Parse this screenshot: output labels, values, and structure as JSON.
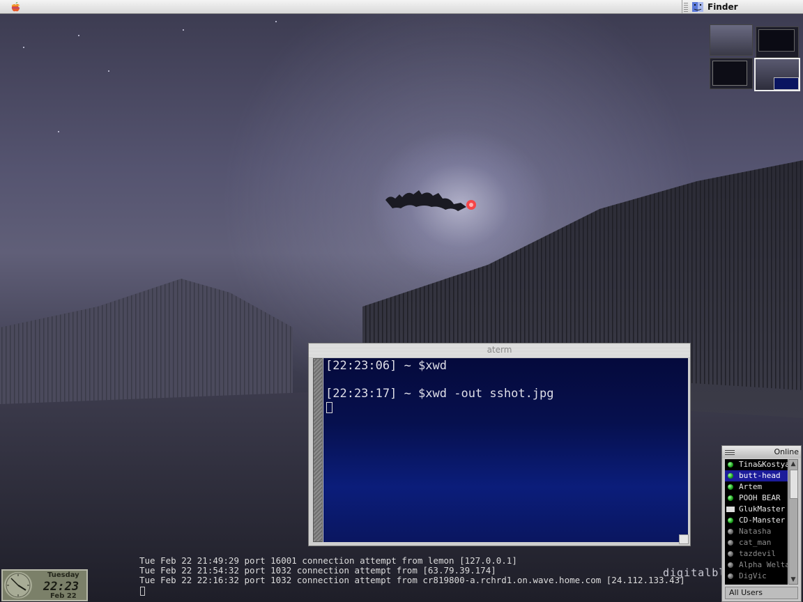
{
  "menubar": {
    "apple_icon": "apple-logo-icon",
    "app_icon": "finder-icon",
    "app_name": "Finder"
  },
  "pager": {
    "desktops": 4,
    "active_desktop": 4
  },
  "terminal": {
    "title": "aterm",
    "lines": [
      "[22:23:06] ~ $xwd",
      "[22:23:17] ~ $xwd -out sshot.jpg"
    ]
  },
  "log": {
    "lines": [
      "Tue Feb 22 21:49:29 port 16001 connection attempt from lemon [127.0.0.1]",
      "Tue Feb 22 21:54:32 port 1032 connection attempt from [63.79.39.174]",
      "Tue Feb 22 22:16:32 port 1032 connection attempt from cr819800-a.rchrd1.on.wave.home.com [24.112.133.43]"
    ]
  },
  "watermark": "digitalbla",
  "clock": {
    "day": "Tuesday",
    "time": "22:23",
    "date": "Feb 22"
  },
  "buddy_list": {
    "status": "Online",
    "footer": "All Users",
    "contacts": [
      {
        "name": "Tina&Kostya",
        "online": true
      },
      {
        "name": "butt-head",
        "online": true,
        "selected": true
      },
      {
        "name": "Artem",
        "online": true
      },
      {
        "name": "POOH BEAR",
        "online": true
      },
      {
        "name": "GlukMaster",
        "online": true,
        "away": true
      },
      {
        "name": "CD-Manster",
        "online": true
      },
      {
        "name": "Natasha",
        "online": false
      },
      {
        "name": "cat_man",
        "online": false
      },
      {
        "name": "tazdevil",
        "online": false
      },
      {
        "name": "Alpha Welta",
        "online": false
      },
      {
        "name": "DigVic",
        "online": false
      }
    ]
  },
  "colors": {
    "terminal_bg": "#06104e",
    "selection": "#1c1c9a",
    "online_dot": "#1aa01a"
  }
}
